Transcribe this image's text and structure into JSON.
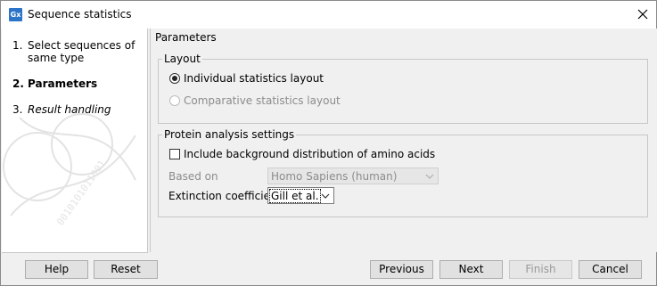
{
  "window": {
    "title": "Sequence statistics",
    "app_icon_text": "Gx"
  },
  "steps": [
    {
      "num": "1.",
      "label": "Select sequences of same type",
      "state": "normal"
    },
    {
      "num": "2.",
      "label": "Parameters",
      "state": "current"
    },
    {
      "num": "3.",
      "label": "Result handling",
      "state": "upcoming"
    }
  ],
  "watermark": {
    "text": "0010101011001"
  },
  "parameters": {
    "title": "Parameters",
    "layout": {
      "legend": "Layout",
      "option_individual": "Individual statistics layout",
      "option_comparative": "Comparative statistics layout",
      "selected": "individual"
    },
    "protein": {
      "legend": "Protein analysis settings",
      "include_background_label": "Include background distribution of amino acids",
      "include_background_checked": false,
      "based_on_label": "Based on",
      "based_on_value": "Homo Sapiens (human)",
      "extinction_label": "Extinction coefficients",
      "extinction_value": "Gill et al."
    }
  },
  "buttons": {
    "help": "Help",
    "reset": "Reset",
    "previous": "Previous",
    "next": "Next",
    "finish": "Finish",
    "cancel": "Cancel"
  },
  "colors": {
    "icon_bg": "#2b74c7",
    "dialog_bg": "#f0f0f0",
    "disabled_text": "#8c8c8c"
  }
}
